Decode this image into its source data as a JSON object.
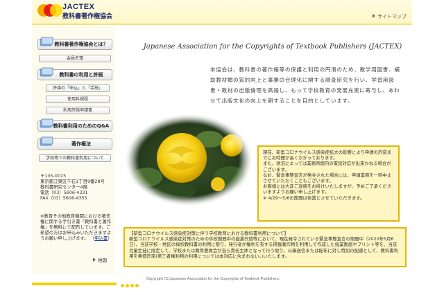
{
  "header": {
    "logo_en": "JACTEX",
    "logo_jp": "教科書著作権協会",
    "sitemap_label": "サイトマップ"
  },
  "sidebar": {
    "nav": [
      {
        "label": "教科書著作権協会とは？",
        "kind": "main"
      },
      {
        "label": "会員名簿",
        "kind": "sub"
      },
      {
        "label": "教科書の利用と許諾",
        "kind": "main"
      },
      {
        "label": "許諾の「申込」と「手続」",
        "kind": "sub"
      },
      {
        "label": "使用料規程",
        "kind": "sub"
      },
      {
        "label": "利用許諾申請書",
        "kind": "sub"
      },
      {
        "label": "教科書利用のためのQ&A",
        "kind": "main"
      },
      {
        "label": "著作権法",
        "kind": "main"
      },
      {
        "label": "学校等での教科書利用について",
        "kind": "sub"
      }
    ],
    "address": [
      "〒135-0015",
      "東京都江東区千石1丁目9番28号",
      "教科書研究センター4階",
      "電話（03）5606-4331",
      "FAX（03）5606-4355"
    ],
    "note": "※教育その他教育機関における著作権に関する手引き書「教科書と著作権」を無料にて配布しています。ご希望の方はお申込みいただきますようお願い申し上げます。",
    "apply_label": "申込書",
    "map_label": "地図"
  },
  "main": {
    "title": "Japanese Association for the Copyrights of Textbook Publishers (JACTEX)",
    "intro": "本協会は、教科書の著作権等の保護と利用の円滑のため、教学用図書、補助教材類の質的向上と事業の合理化に関する調査研究を行い、学習用図書・教材の出版倫理を高揚し、もって学校教育の発展充実に寄与し、あわせて出版文化の向上を期することを目的としています。",
    "notice1": [
      "現在、新型コロナウイルス感染症拡大の影響により申請の許諾までにお時間が長くかかっております。",
      "また、状況によっては業務時間内の電話対応が出来かねる場合がございます。",
      "なお、緊急事態宣言が発令された場合には、申請業務を一時中止させていただくこともございます。",
      "お客様には大変ご迷惑をお掛けいたしますが、予めご了承くださいますようお願い申し上げます。",
      "※ 4/29～5/6の期間は休業とさせていただきます。"
    ],
    "notice2": [
      "【新型コロナウイルス感染症対策に伴う学校教育における教科書利用について】",
      "新型コロナウイルス感染症対策のための休校期間中の授業代替等において、現在発令されている緊急事態宣言の期間中（2020年5月6日）、当該学校・地区の採択教科書の利用に限り、発行者が権利を有する掲載著作物を利用して作成した授業動画やプリント等を、当該児童生徒に限定して、学校または教育委員会が自ら責任主体となって行う限り、公衆送信または配布に対し特別の配慮として、教科書利用を無償許諾(第三者権利物の利用については本対応に含まれない。)いたします。"
    ]
  },
  "footer": {
    "copyright": "Copyright (C)Japanese Association for the Copyrights of Textbook Publishers."
  }
}
